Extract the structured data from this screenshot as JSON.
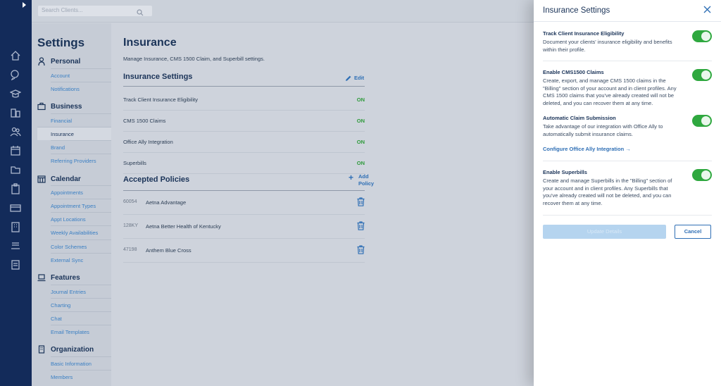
{
  "search": {
    "placeholder": "Search Clients..."
  },
  "sidebar": {
    "title": "Settings",
    "sections": [
      {
        "label": "Personal",
        "items": [
          "Account",
          "Notifications"
        ]
      },
      {
        "label": "Business",
        "items": [
          "Financial",
          "Insurance",
          "Brand",
          "Referring Providers"
        ]
      },
      {
        "label": "Calendar",
        "items": [
          "Appointments",
          "Appointment Types",
          "Appt Locations",
          "Weekly Availabilities",
          "Color Schemes",
          "External Sync"
        ]
      },
      {
        "label": "Features",
        "items": [
          "Journal Entries",
          "Charting",
          "Chat",
          "Email Templates"
        ]
      },
      {
        "label": "Organization",
        "items": [
          "Basic Information",
          "Members"
        ]
      }
    ],
    "active_item": "Insurance"
  },
  "main": {
    "title": "Insurance",
    "subtitle": "Manage Insurance, CMS 1500 Claim, and Superbill settings.",
    "insurance_settings": {
      "heading": "Insurance Settings",
      "edit_label": "Edit",
      "rows": [
        {
          "label": "Track Client Insurance Eligibility",
          "status": "ON"
        },
        {
          "label": "CMS 1500 Claims",
          "status": "ON"
        },
        {
          "label": "Office Ally Integration",
          "status": "ON"
        },
        {
          "label": "Superbills",
          "status": "ON"
        }
      ]
    },
    "accepted_policies": {
      "heading": "Accepted Policies",
      "add_label": "Add Policy",
      "policies": [
        {
          "code": "60054",
          "name": "Aetna Advantage"
        },
        {
          "code": "128KY",
          "name": "Aetna Better Health of Kentucky"
        },
        {
          "code": "47198",
          "name": "Anthem Blue Cross"
        }
      ]
    }
  },
  "drawer": {
    "title": "Insurance Settings",
    "options": [
      {
        "heading": "Track Client Insurance Eligibility",
        "description": "Document your clients' insurance eligibility and benefits within their profile.",
        "enabled": true
      },
      {
        "heading": "Enable CMS1500 Claims",
        "description": "Create, export, and manage CMS 1500 claims in the \"Billing\" section of your account and in client profiles. Any CMS 1500 claims that you've already created will not be deleted, and you can recover them at any time.",
        "enabled": true
      },
      {
        "heading": "Automatic Claim Submission",
        "description": "Take advantage of our integration with Office Ally to automatically submit insurance claims.",
        "enabled": true
      },
      {
        "heading": "Enable Superbills",
        "description": "Create and manage Superbills in the \"Billing\" section of your account and in client profiles. Any Superbills that you've already created will not be deleted, and you can recover them at any time.",
        "enabled": true
      }
    ],
    "configure_link": "Configure Office Ally Integration →",
    "update_button": "Update Details",
    "cancel_button": "Cancel"
  },
  "colors": {
    "accent": "#2f6fb5",
    "on_green": "#2d9a3a",
    "toggle_green": "#2fa83f",
    "rail": "#132b5a"
  }
}
